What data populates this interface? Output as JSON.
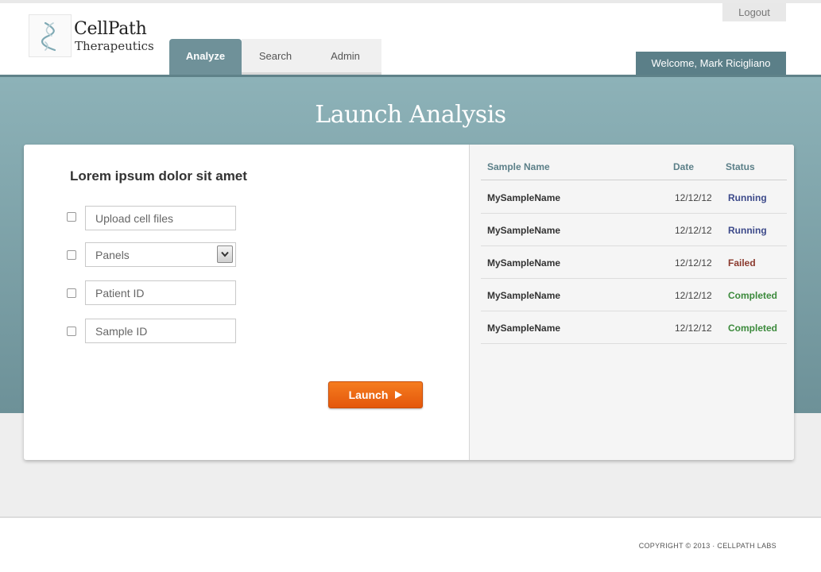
{
  "brand": {
    "name": "CellPath",
    "tagline": "Therapeutics"
  },
  "nav": {
    "tabs": [
      {
        "label": "Analyze",
        "active": true
      },
      {
        "label": "Search"
      },
      {
        "label": "Admin"
      }
    ]
  },
  "header": {
    "logout_label": "Logout",
    "welcome_text": "Welcome, Mark Ricigliano"
  },
  "page": {
    "title": "Launch Analysis"
  },
  "form": {
    "title": "Lorem ipsum dolor sit amet",
    "upload_placeholder": "Upload cell files",
    "panels_value": "Panels",
    "patient_placeholder": "Patient ID",
    "sample_placeholder": "Sample ID",
    "launch_label": "Launch"
  },
  "table": {
    "headers": [
      "Sample Name",
      "Date",
      "Status"
    ],
    "rows": [
      {
        "name": "MySampleName",
        "date": "12/12/12",
        "status": "Running"
      },
      {
        "name": "MySampleName",
        "date": "12/12/12",
        "status": "Running"
      },
      {
        "name": "MySampleName",
        "date": "12/12/12",
        "status": "Failed"
      },
      {
        "name": "MySampleName",
        "date": "12/12/12",
        "status": "Completed"
      },
      {
        "name": "MySampleName",
        "date": "12/12/12",
        "status": "Completed"
      }
    ]
  },
  "status_colors": {
    "Running": "#3d4a8a",
    "Failed": "#8b3a2e",
    "Completed": "#3c8a3c"
  },
  "colors": {
    "accent": "#6f9199",
    "launch": "#ef6a14"
  },
  "footer": {
    "copyright": "COPYRIGHT © 2013 · CELLPATH LABS"
  }
}
